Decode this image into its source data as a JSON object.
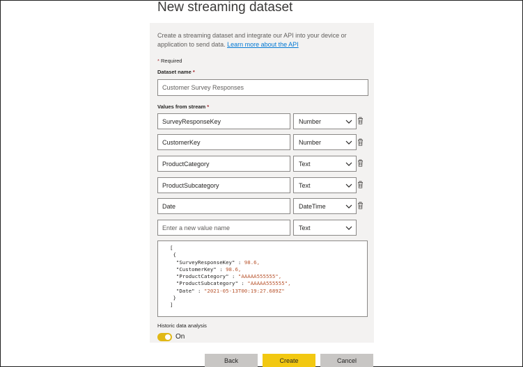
{
  "dialog": {
    "title": "New streaming dataset",
    "description": "Create a streaming dataset and integrate our API into your device or application to send data.",
    "learn_more_link": "Learn more about the API",
    "required_note": "Required",
    "dataset_name_label": "Dataset name",
    "dataset_name_value": "Customer Survey Responses",
    "values_label": "Values from stream",
    "fields": [
      {
        "name": "SurveyResponseKey",
        "type": "Number"
      },
      {
        "name": "CustomerKey",
        "type": "Number"
      },
      {
        "name": "ProductCategory",
        "type": "Text"
      },
      {
        "name": "ProductSubcategory",
        "type": "Text"
      },
      {
        "name": "Date",
        "type": "DateTime"
      }
    ],
    "new_field_placeholder": "Enter a new value name",
    "new_field_type": "Text",
    "json_preview": {
      "open_bracket": "[",
      "open_brace": "{",
      "lines": [
        {
          "key": "\"SurveyResponseKey\" : ",
          "value": "98.6,"
        },
        {
          "key": "\"CustomerKey\" : ",
          "value": "98.6,"
        },
        {
          "key": "\"ProductCategory\" : ",
          "value": "\"AAAAA555555\","
        },
        {
          "key": "\"ProductSubcategory\" : ",
          "value": "\"AAAAA555555\","
        },
        {
          "key": "\"Date\" : ",
          "value": "\"2021-05-13T00:19:27.689Z\""
        }
      ],
      "close_brace": "}",
      "close_bracket": "]"
    },
    "historic_label": "Historic data analysis",
    "historic_state": "On",
    "buttons": {
      "back": "Back",
      "create": "Create",
      "cancel": "Cancel"
    },
    "colors": {
      "accent": "#f2c811",
      "toggle": "#e1b816",
      "link": "#0078d4",
      "required": "#a4262c",
      "panel": "#f3f2f1"
    }
  }
}
